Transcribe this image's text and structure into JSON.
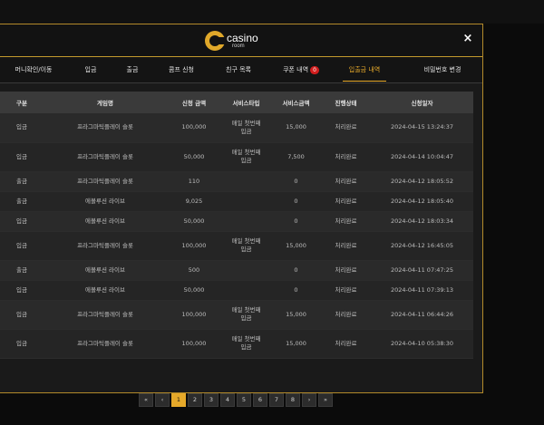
{
  "modal": {
    "logo_main": "casino",
    "logo_sub": "room",
    "close": "×"
  },
  "tabs": [
    {
      "label": "머니확인/이동"
    },
    {
      "label": "입금"
    },
    {
      "label": "출금"
    },
    {
      "label": "콤프 신청"
    },
    {
      "label": "친구 목록"
    },
    {
      "label": "쿠폰 내역",
      "badge": "0"
    },
    {
      "label": "입출금 내역",
      "active": true
    },
    {
      "label": "비밀번호 변경"
    }
  ],
  "table": {
    "headers": [
      "구분",
      "게임명",
      "신청 금액",
      "서비스타입",
      "서비스금액",
      "진행상태",
      "신청일자"
    ],
    "rows": [
      {
        "type": "입금",
        "game": "프라그마틱플레이 슬롯",
        "amount": "100,000",
        "service_type": "매일 첫번째\n입금",
        "service_amount": "15,000",
        "status": "처리완료",
        "date": "2024-04-15 13:24:37"
      },
      {
        "type": "입금",
        "game": "프라그마틱플레이 슬롯",
        "amount": "50,000",
        "service_type": "매일 첫번째\n입금",
        "service_amount": "7,500",
        "status": "처리완료",
        "date": "2024-04-14 10:04:47"
      },
      {
        "type": "출금",
        "game": "프라그마틱플레이 슬롯",
        "amount": "110",
        "service_type": "",
        "service_amount": "0",
        "status": "처리완료",
        "date": "2024-04-12 18:05:52"
      },
      {
        "type": "출금",
        "game": "에볼루션 라이브",
        "amount": "9,025",
        "service_type": "",
        "service_amount": "0",
        "status": "처리완료",
        "date": "2024-04-12 18:05:40"
      },
      {
        "type": "입금",
        "game": "에볼루션 라이브",
        "amount": "50,000",
        "service_type": "",
        "service_amount": "0",
        "status": "처리완료",
        "date": "2024-04-12 18:03:34"
      },
      {
        "type": "입금",
        "game": "프라그마틱플레이 슬롯",
        "amount": "100,000",
        "service_type": "매일 첫번째\n입금",
        "service_amount": "15,000",
        "status": "처리완료",
        "date": "2024-04-12 16:45:05"
      },
      {
        "type": "출금",
        "game": "에볼루션 라이브",
        "amount": "500",
        "service_type": "",
        "service_amount": "0",
        "status": "처리완료",
        "date": "2024-04-11 07:47:25"
      },
      {
        "type": "입금",
        "game": "에볼루션 라이브",
        "amount": "50,000",
        "service_type": "",
        "service_amount": "0",
        "status": "처리완료",
        "date": "2024-04-11 07:39:13"
      },
      {
        "type": "입금",
        "game": "프라그마틱플레이 슬롯",
        "amount": "100,000",
        "service_type": "매일 첫번째\n입금",
        "service_amount": "15,000",
        "status": "처리완료",
        "date": "2024-04-11 06:44:26"
      },
      {
        "type": "입금",
        "game": "프라그마틱플레이 슬롯",
        "amount": "100,000",
        "service_type": "매일 첫번째\n입금",
        "service_amount": "15,000",
        "status": "처리완료",
        "date": "2024-04-10 05:38:30"
      }
    ]
  },
  "pagination": {
    "first": "«",
    "prev": "‹",
    "pages": [
      "1",
      "2",
      "3",
      "4",
      "5",
      "6",
      "7",
      "8"
    ],
    "current": "1",
    "next": "›",
    "last": "»"
  },
  "colors": {
    "accent": "#e6a92a",
    "badge": "#d11d1d"
  }
}
